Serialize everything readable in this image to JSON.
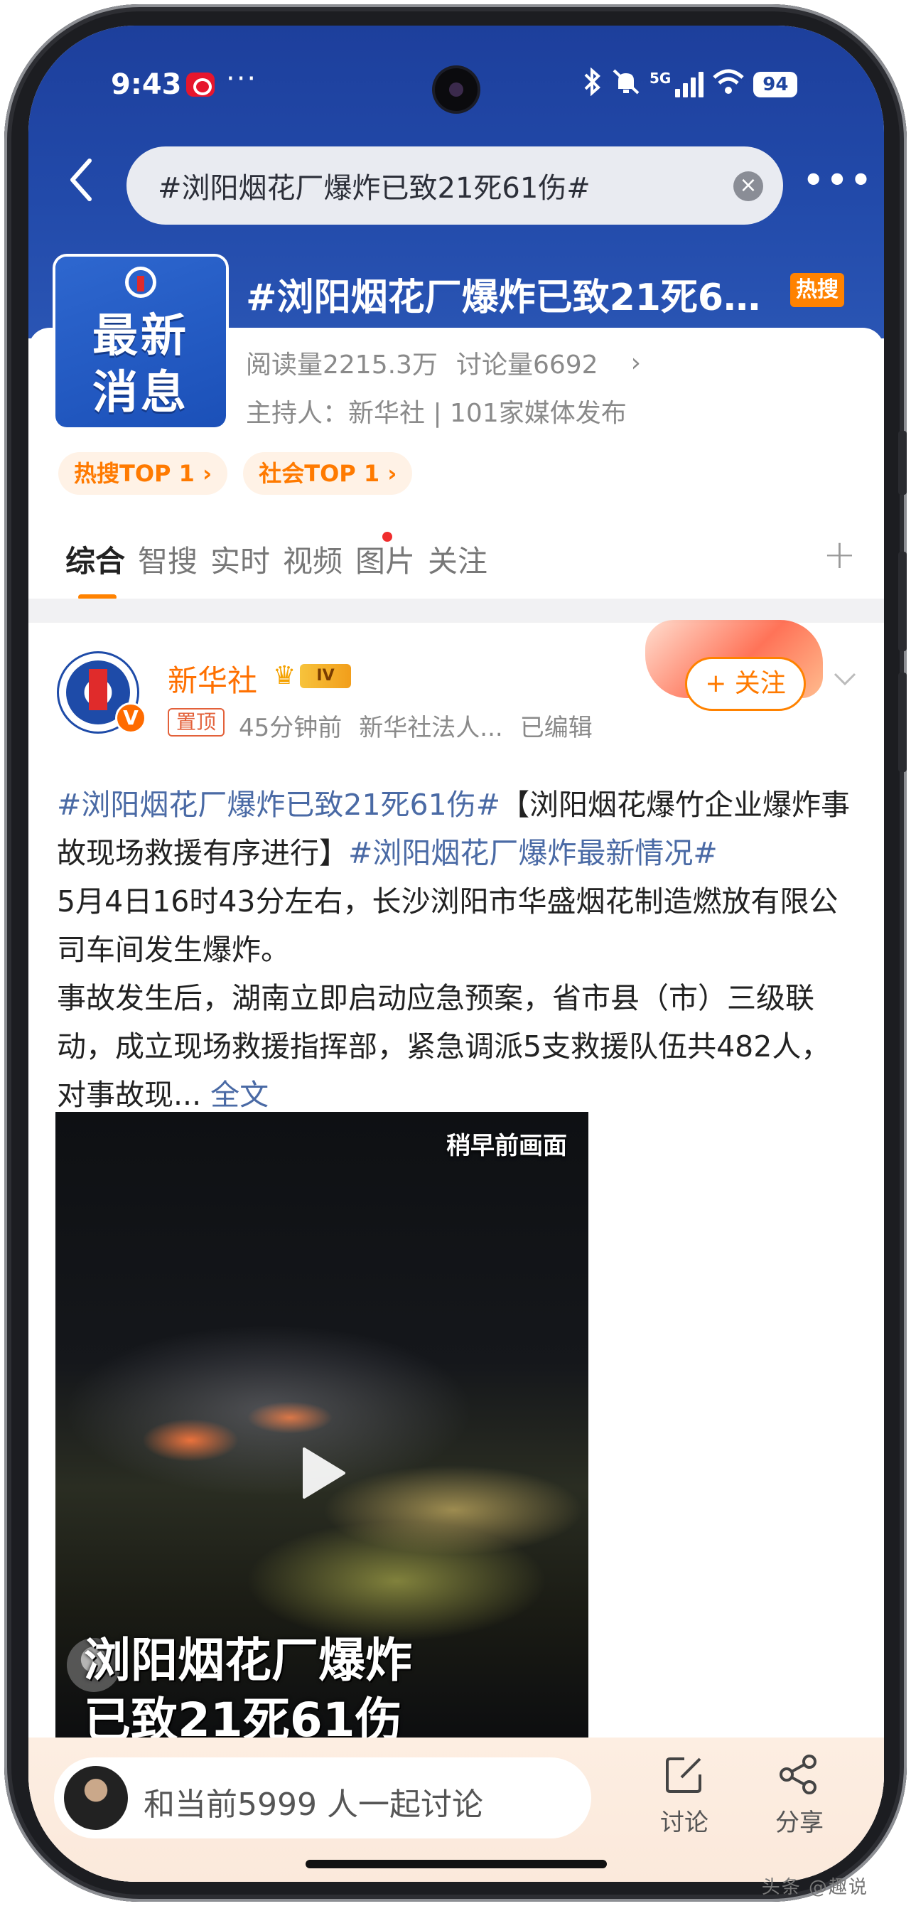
{
  "status_bar": {
    "time": "9:43",
    "more": "···",
    "network": "5G",
    "battery": "94"
  },
  "search": {
    "query": "#浏阳烟花厂爆炸已致21死61伤#"
  },
  "topic": {
    "logo_line1": "最新",
    "logo_line2": "消息",
    "title": "#浏阳烟花厂爆炸已致21死6…",
    "hot_badge": "热搜",
    "reads": "阅读量2215.3万",
    "discussions": "讨论量6692",
    "host": "主持人：新华社 | 101家媒体发布",
    "chips": [
      "热搜TOP 1 ›",
      "社会TOP 1 ›"
    ]
  },
  "tabs": [
    "综合",
    "智搜",
    "实时",
    "视频",
    "图片",
    "关注"
  ],
  "post": {
    "author": "新华社",
    "level": "IV",
    "pin": "置顶",
    "time": "45分钟前",
    "source": "新华社法人...",
    "edited": "已编辑",
    "follow": "+ 关注",
    "body": {
      "tag1": "#浏阳烟花厂爆炸已致21死61伤#",
      "headline": "【浏阳烟花爆竹企业爆炸事故现场救援有序进行】",
      "tag2": "#浏阳烟花厂爆炸最新情况#",
      "p1": "5月4日16时43分左右，长沙浏阳市华盛烟花制造燃放有限公司车间发生爆炸。",
      "p2": "事故发生后，湖南立即启动应急预案，省市县（市）三级联动，成立现场救援指挥部，紧急调派5支救援队伍共482人，对事故现...",
      "more": "全文"
    },
    "video": {
      "label": "稍早前画面",
      "caption_line1": "浏阳烟花厂爆炸",
      "caption_line2": "已致21死61伤"
    }
  },
  "bottom": {
    "discuss_placeholder": "和当前5999 人一起讨论",
    "discuss_label": "讨论",
    "share_label": "分享"
  },
  "watermark": "头条 @趣说"
}
